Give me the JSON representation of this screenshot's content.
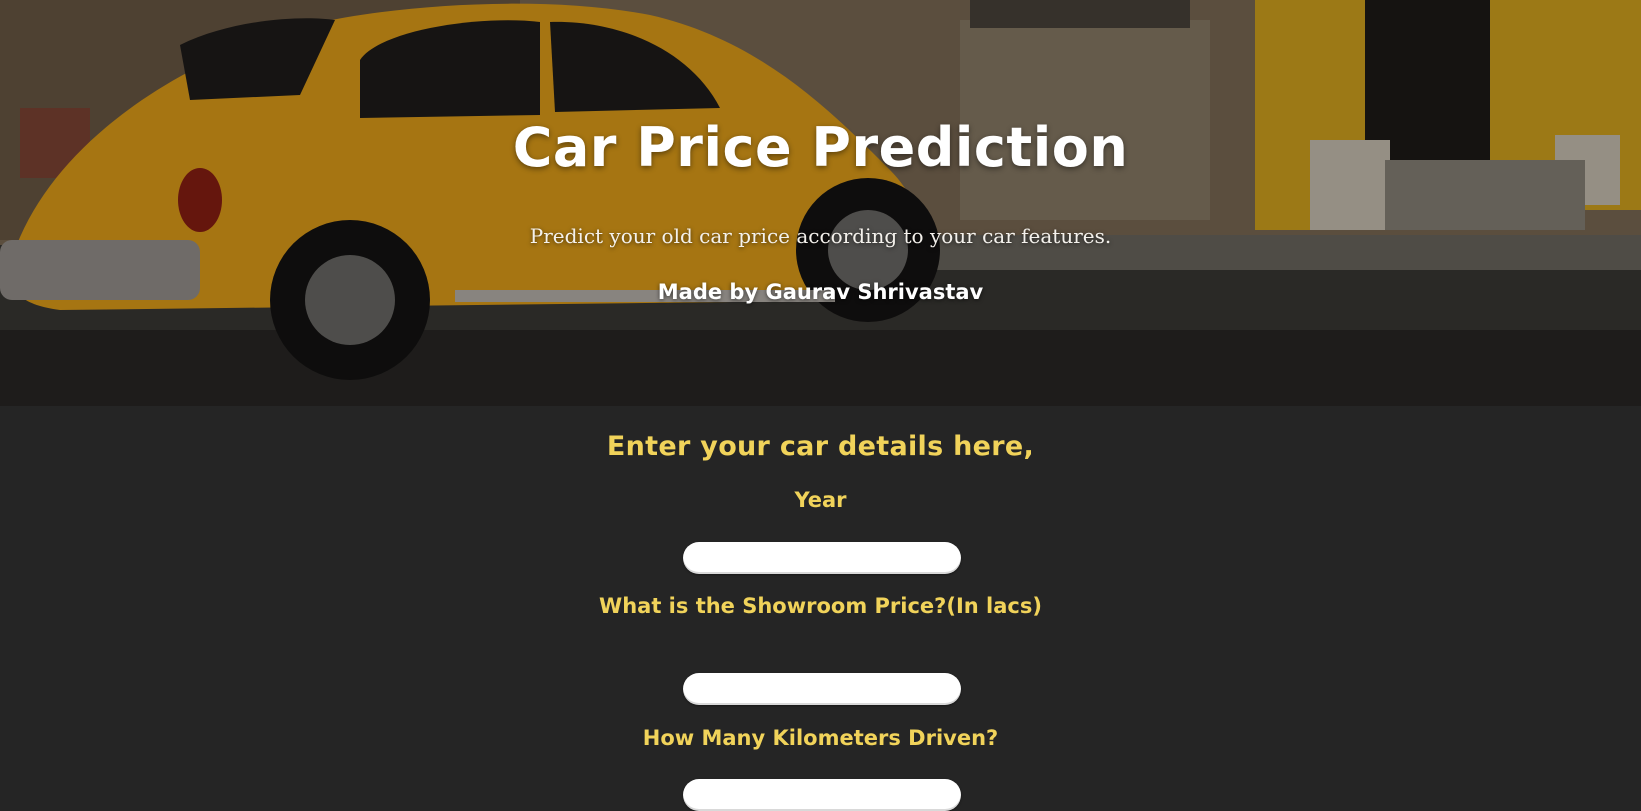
{
  "hero": {
    "title": "Car Price Prediction",
    "tagline": "Predict your old car price according to your car features.",
    "author": "Made by Gaurav Shrivastav"
  },
  "form": {
    "heading": "Enter your car details here,",
    "fields": [
      {
        "label": "Year",
        "value": ""
      },
      {
        "label": "What is the Showroom Price?(In lacs)",
        "value": ""
      },
      {
        "label": "How Many Kilometers Driven?",
        "value": ""
      }
    ]
  },
  "colors": {
    "page_background": "#252525",
    "accent_label": "#f1d35a",
    "car_body": "#e7a21a",
    "building_trim": "#d8a81f"
  }
}
